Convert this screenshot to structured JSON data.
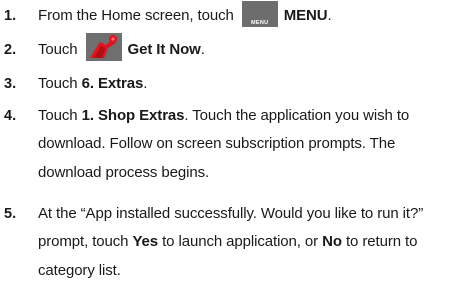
{
  "steps": [
    {
      "number": "1.",
      "pre": "From the Home screen, touch",
      "icon_caption": "MENU",
      "bold": "MENU",
      "post": "."
    },
    {
      "number": "2.",
      "pre": "Touch",
      "bold": "Get It Now",
      "post": "."
    },
    {
      "number": "3.",
      "pre": "Touch ",
      "bold": "6. Extras",
      "post": "."
    },
    {
      "number": "4.",
      "pre": "Touch ",
      "bold": "1. Shop Extras",
      "post": ". Touch the application you wish to download. Follow on screen subscription prompts. The download process begins."
    },
    {
      "number": "5.",
      "pre": "At the “App installed successfully. Would you like to run it?” prompt, touch ",
      "bold": "Yes",
      "mid": " to launch application, or ",
      "bold2": "No",
      "post": " to return to category list."
    }
  ],
  "icons": {
    "menu": "menu-grid-icon",
    "get_it_now": "get-it-now-icon"
  },
  "colors": {
    "icon_bg": "#6d6d6d",
    "get_it_now_red": "#e0141e"
  }
}
